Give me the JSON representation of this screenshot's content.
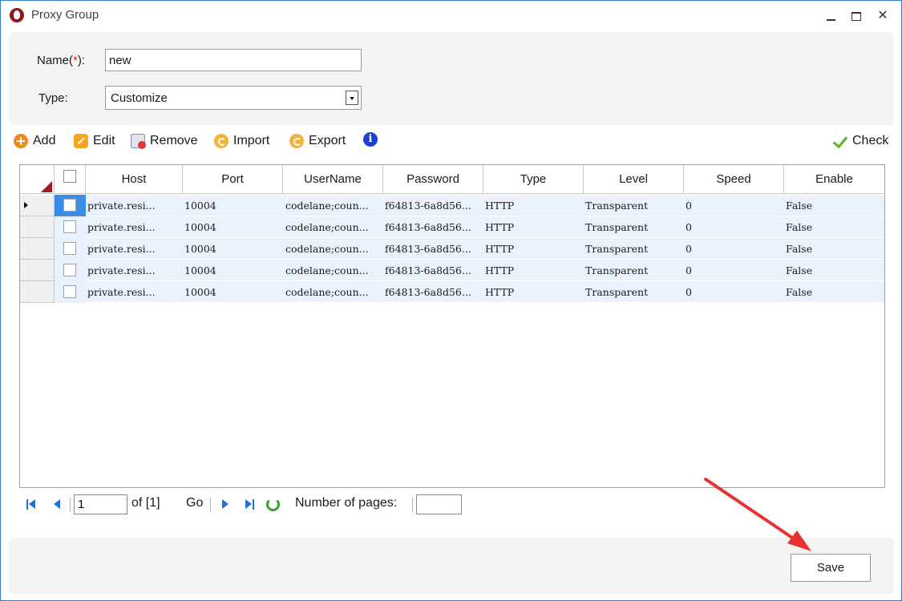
{
  "window": {
    "title": "Proxy Group",
    "controls": [
      "minimize-icon",
      "maximize-icon",
      "close-icon"
    ]
  },
  "form": {
    "name_label": "Name(",
    "name_required_mark": "*",
    "name_label_suffix": "):",
    "name_value": "new",
    "type_label": "Type:",
    "type_value": "Customize"
  },
  "toolbar": {
    "add": "Add",
    "edit": "Edit",
    "remove": "Remove",
    "import": "Import",
    "export": "Export",
    "check": "Check"
  },
  "grid": {
    "columns": [
      "Host",
      "Port",
      "UserName",
      "Password",
      "Type",
      "Level",
      "Speed",
      "Enable"
    ],
    "rows": [
      {
        "host": "private.resi...",
        "port": "10004",
        "username": "codelane;coun...",
        "password": "f64813-6a8d56...",
        "type": "HTTP",
        "level": "Transparent",
        "speed": "0",
        "enable": "False"
      },
      {
        "host": "private.resi...",
        "port": "10004",
        "username": "codelane;coun...",
        "password": "f64813-6a8d56...",
        "type": "HTTP",
        "level": "Transparent",
        "speed": "0",
        "enable": "False"
      },
      {
        "host": "private.resi...",
        "port": "10004",
        "username": "codelane;coun...",
        "password": "f64813-6a8d56...",
        "type": "HTTP",
        "level": "Transparent",
        "speed": "0",
        "enable": "False"
      },
      {
        "host": "private.resi...",
        "port": "10004",
        "username": "codelane;coun...",
        "password": "f64813-6a8d56...",
        "type": "HTTP",
        "level": "Transparent",
        "speed": "0",
        "enable": "False"
      },
      {
        "host": "private.resi...",
        "port": "10004",
        "username": "codelane;coun...",
        "password": "f64813-6a8d56...",
        "type": "HTTP",
        "level": "Transparent",
        "speed": "0",
        "enable": "False"
      }
    ]
  },
  "pager": {
    "page_value": "1",
    "of_text": "of [1]",
    "go": "Go",
    "pages_label": "Number of pages:",
    "pages_value": ""
  },
  "footer": {
    "save": "Save"
  },
  "colors": {
    "window_border": "#2b7bd0",
    "panel_bg": "#f3f3f3",
    "row_bg": "#eaf3fd",
    "selected_cell": "#3b8de6",
    "annotation_arrow": "#e8322f"
  }
}
